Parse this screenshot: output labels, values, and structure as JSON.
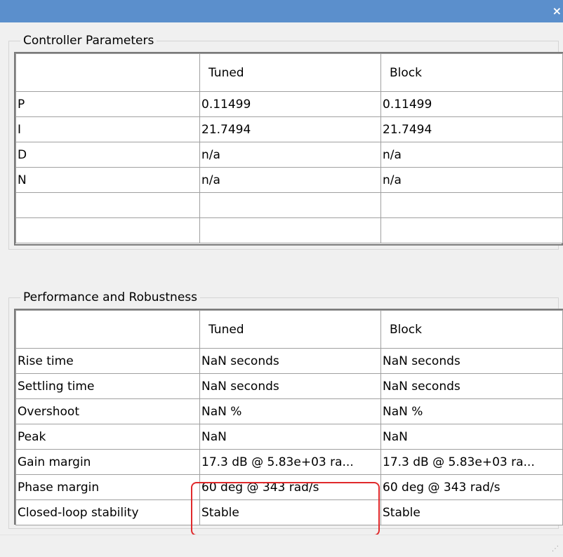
{
  "window": {
    "close_icon": "close-icon"
  },
  "controller_parameters": {
    "title": "Controller Parameters",
    "columns": [
      "",
      "Tuned",
      "Block"
    ],
    "rows": [
      [
        "P",
        "0.11499",
        "0.11499"
      ],
      [
        "I",
        "21.7494",
        "21.7494"
      ],
      [
        "D",
        "n/a",
        "n/a"
      ],
      [
        "N",
        "n/a",
        "n/a"
      ],
      [
        "",
        "",
        ""
      ],
      [
        "",
        "",
        ""
      ]
    ]
  },
  "performance": {
    "title": "Performance and Robustness",
    "columns": [
      "",
      "Tuned",
      "Block"
    ],
    "rows": [
      [
        "Rise time",
        "NaN seconds",
        "NaN seconds"
      ],
      [
        "Settling time",
        "NaN seconds",
        "NaN seconds"
      ],
      [
        "Overshoot",
        "NaN %",
        "NaN %"
      ],
      [
        "Peak",
        "NaN",
        "NaN"
      ],
      [
        "Gain margin",
        "17.3 dB @ 5.83e+03 ra...",
        "17.3 dB @ 5.83e+03 ra..."
      ],
      [
        "Phase margin",
        "60 deg @ 343 rad/s",
        "60 deg @ 343 rad/s"
      ],
      [
        "Closed-loop stability",
        "Stable",
        "Stable"
      ]
    ]
  },
  "highlight_color": "#e0292b"
}
